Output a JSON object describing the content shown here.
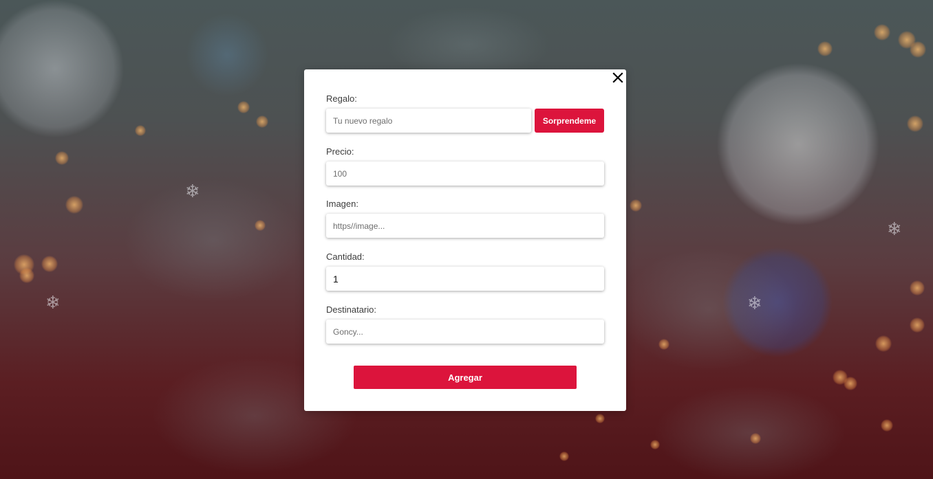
{
  "form": {
    "close_icon": "close-icon",
    "gift": {
      "label": "Regalo:",
      "placeholder": "Tu nuevo regalo",
      "value": "",
      "surprise_label": "Sorprendeme"
    },
    "price": {
      "label": "Precio:",
      "placeholder": "100",
      "value": ""
    },
    "image": {
      "label": "Imagen:",
      "placeholder": "https//image...",
      "value": ""
    },
    "quantity": {
      "label": "Cantidad:",
      "placeholder": "",
      "value": "1"
    },
    "recipient": {
      "label": "Destinatario:",
      "placeholder": "Goncy...",
      "value": ""
    },
    "submit_label": "Agregar"
  },
  "background_icons": [
    "snowflake-icon",
    "snowflake-icon",
    "snowflake-icon",
    "snowflake-icon",
    "snowflake-icon"
  ],
  "colors": {
    "accent": "#dc143c",
    "modal_background": "#ffffff",
    "label_text": "#3c3c3c"
  }
}
